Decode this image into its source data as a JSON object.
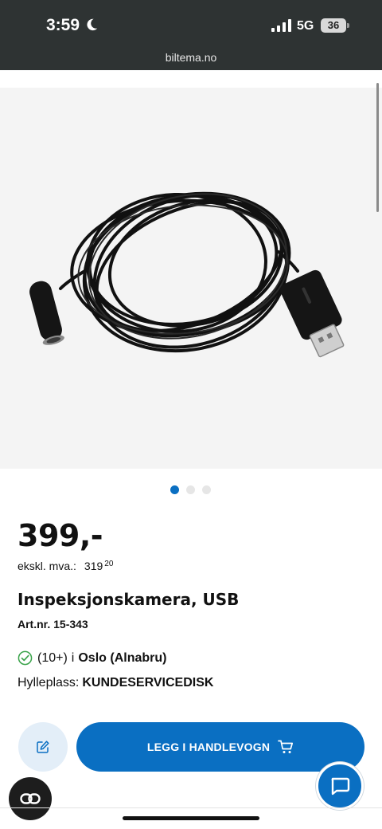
{
  "status_bar": {
    "time": "3:59",
    "network": "5G",
    "battery": "36",
    "url": "biltema.no"
  },
  "icons": {
    "moon": "moon-icon",
    "signal": "signal-bars-icon",
    "battery": "battery-icon",
    "edit": "edit-icon",
    "cart": "cart-icon",
    "chat": "chat-bubble-icon",
    "link": "link-icon",
    "check": "check-circle-icon"
  },
  "gallery": {
    "image_alt": "Inspeksjonskamera, USB",
    "total_images": 3,
    "active_index": 0
  },
  "product": {
    "price": "399,-",
    "vat_label": "ekskl. mva.:",
    "vat_value": "319",
    "vat_cents": "20",
    "title": "Inspeksjonskamera, USB",
    "art_nr": "Art.nr. 15-343"
  },
  "stock": {
    "count": "(10+)",
    "prefix": "i",
    "store": "Oslo (Alnabru)",
    "shelf_label": "Hylleplass:",
    "shelf_value": "KUNDESERVICEDISK"
  },
  "actions": {
    "add_to_cart": "LEGG I HANDLEVOGN"
  },
  "colors": {
    "brand_blue": "#0a6fc2",
    "status_bar": "#2e3333",
    "check_green": "#3aa34a"
  }
}
